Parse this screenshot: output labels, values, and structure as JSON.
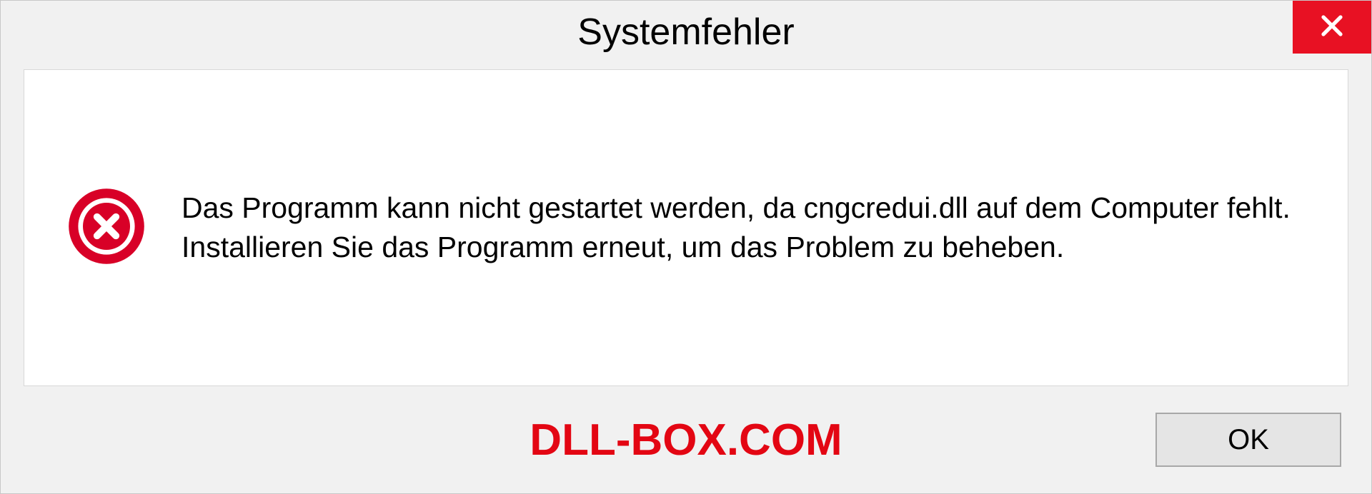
{
  "dialog": {
    "title": "Systemfehler",
    "message": "Das Programm kann nicht gestartet werden, da cngcredui.dll auf dem Computer fehlt. Installieren Sie das Programm erneut, um das Problem zu beheben.",
    "ok_label": "OK"
  },
  "watermark": "DLL-BOX.COM",
  "colors": {
    "close_bg": "#e81123",
    "error_icon": "#d80027",
    "watermark": "#e30613"
  }
}
